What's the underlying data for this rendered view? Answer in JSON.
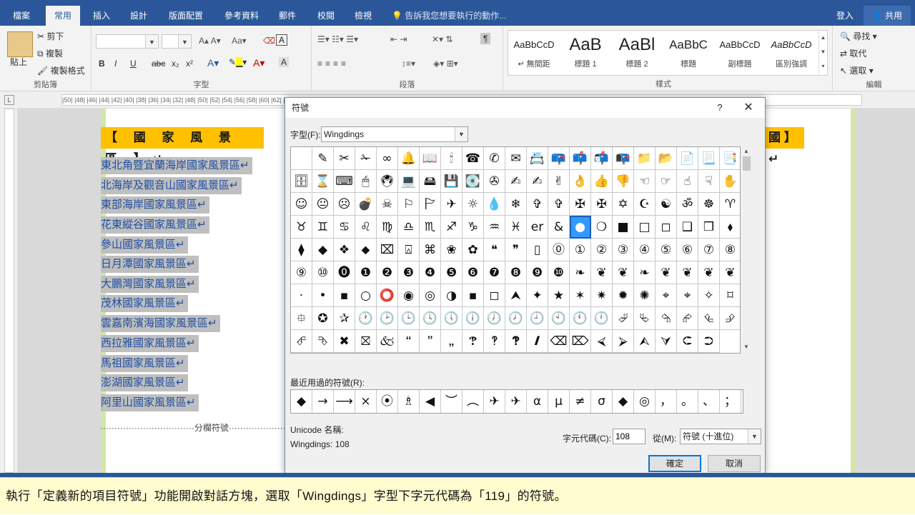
{
  "tabs": [
    "檔案",
    "常用",
    "插入",
    "設計",
    "版面配置",
    "參考資料",
    "郵件",
    "校閱",
    "檢視"
  ],
  "tell_me": "告訴我您想要執行的動作...",
  "sign_in": "登入",
  "share": "共用",
  "ribbon": {
    "clipboard": {
      "label": "剪貼簿",
      "paste": "貼上",
      "cut": "剪下",
      "copy": "複製",
      "format_painter": "複製格式"
    },
    "font": {
      "label": "字型",
      "bold": "B",
      "italic": "I",
      "underline": "U",
      "strike": "abc",
      "subscript": "x₂",
      "superscript": "x²"
    },
    "paragraph": {
      "label": "段落"
    },
    "styles": {
      "label": "樣式",
      "items": [
        {
          "preview": "AaBbCcD",
          "name": "↵ 無間距"
        },
        {
          "preview": "AaB",
          "name": "標題 1"
        },
        {
          "preview": "AaBl",
          "name": "標題 2"
        },
        {
          "preview": "AaBbC",
          "name": "標題"
        },
        {
          "preview": "AaBbCcD",
          "name": "副標題"
        },
        {
          "preview": "AaBbCcD",
          "name": "區別強調"
        }
      ]
    },
    "editing": {
      "label": "編輯",
      "find": "尋找",
      "replace": "取代",
      "select": "選取"
    }
  },
  "ruler": "|50| |48| |46| |44| |42| |40| |38| |36| |34| |32|                                                                                                                                                         |48| |50| |52| |54| |56| |58| |60| |62| |64|   |18|",
  "document": {
    "heading": "【 國 家 風 景 區 】↵",
    "heading2": "國 】↵",
    "items": [
      "東北角暨宜蘭海岸國家風景區↵",
      "北海岸及觀音山國家風景區↵",
      "東部海岸國家風景區↵",
      "花東縱谷國家風景區↵",
      "參山國家風景區↵",
      "日月潭國家風景區↵",
      "大鵬灣國家風景區↵",
      "茂林國家風景區↵",
      "雲嘉南濱海國家風景區↵",
      "西拉雅國家風景區↵",
      "馬祖國家風景區↵",
      "澎湖國家風景區↵",
      "阿里山國家風景區↵"
    ],
    "column_break": "·································分欄符號·································"
  },
  "dialog": {
    "title": "符號",
    "help": "?",
    "close": "✕",
    "font_label": "字型(F):",
    "font_value": "Wingdings",
    "symbols": [
      "",
      "✎",
      "✂",
      "✁",
      "∞",
      "🔔",
      "📖",
      "🕯",
      "☎",
      "✆",
      "✉",
      "📇",
      "📪",
      "📫",
      "📬",
      "📭",
      "📁",
      "📂",
      "📄",
      "📃",
      "📑",
      "🗄",
      "⌛",
      "⌨",
      "🖱",
      "🖲",
      "💻",
      "🖴",
      "💾",
      "💽",
      "✇",
      "✍",
      "✍",
      "✌",
      "👌",
      "👍",
      "👎",
      "☜",
      "☞",
      "☝",
      "☟",
      "✋",
      "☺",
      "😐",
      "☹",
      "💣",
      "☠",
      "⚐",
      "🏱",
      "✈",
      "☼",
      "💧",
      "❄",
      "✞",
      "✞",
      "✠",
      "✠",
      "✡",
      "☪",
      "☯",
      "ॐ",
      "☸",
      "♈",
      "♉",
      "♊",
      "♋",
      "♌",
      "♍",
      "♎",
      "♏",
      "♐",
      "♑",
      "♒",
      "♓",
      "er",
      "&",
      "●",
      "❍",
      "■",
      "□",
      "◻",
      "❑",
      "❒",
      "⬧",
      "⧫",
      "◆",
      "❖",
      "⬥",
      "⌧",
      "⍓",
      "⌘",
      "❀",
      "✿",
      "❝",
      "❞",
      "▯",
      "⓪",
      "①",
      "②",
      "③",
      "④",
      "⑤",
      "⑥",
      "⑦",
      "⑧",
      "⑨",
      "⑩",
      "⓿",
      "❶",
      "❷",
      "❸",
      "❹",
      "❺",
      "❻",
      "❼",
      "❽",
      "❾",
      "❿",
      "❧",
      "❦",
      "❦",
      "❧",
      "❦",
      "❦",
      "❦",
      "❦",
      "·",
      "•",
      "▪",
      "○",
      "⭕",
      "◉",
      "◎",
      "◑",
      "▪",
      "◻",
      "⮝",
      "✦",
      "★",
      "✶",
      "✷",
      "✹",
      "✺",
      "⌖",
      "⌖",
      "✧",
      "⌑",
      "⯐",
      "✪",
      "✰",
      "🕐",
      "🕑",
      "🕒",
      "🕓",
      "🕔",
      "🕕",
      "🕖",
      "🕗",
      "🕘",
      "🕙",
      "🕚",
      "🕛",
      "⮰",
      "⮱",
      "⮲",
      "⮳",
      "⮴",
      "⮵",
      "⮶",
      "⮷",
      "✖",
      "⛝",
      "🙵",
      "🙶",
      "🙷",
      "🙸",
      "🙹",
      "🙺",
      "🙻",
      "🙼",
      "⌫",
      "⌦",
      "⮘",
      "⮚",
      "⮙",
      "⮛",
      "⮈",
      "⮊"
    ],
    "selected_index": 76,
    "recent_label": "最近用過的符號(R):",
    "recent": [
      "◆",
      "→",
      "⟶",
      "×",
      "⦿",
      "♗",
      "◀",
      "︶",
      "︵",
      "✈",
      "✈",
      "α",
      "μ",
      "≠",
      "σ",
      "◆",
      "◎",
      "，",
      "。",
      "、",
      "；"
    ],
    "unicode_name_label": "Unicode 名稱:",
    "unicode_name_value": "Wingdings: 108",
    "char_code_label": "字元代碼(C):",
    "char_code_value": "108",
    "from_label": "從(M):",
    "from_value": "符號 (十進位)",
    "ok": "確定",
    "cancel": "取消"
  },
  "caption": "執行「定義新的項目符號」功能開啟對話方塊，選取「Wingdings」字型下字元代碼為「119」的符號。",
  "colors": {
    "accent": "#2b579a",
    "heading_bg": "#ffc000",
    "selection": "#bfbfbf",
    "item_text": "#1f4ea1"
  }
}
